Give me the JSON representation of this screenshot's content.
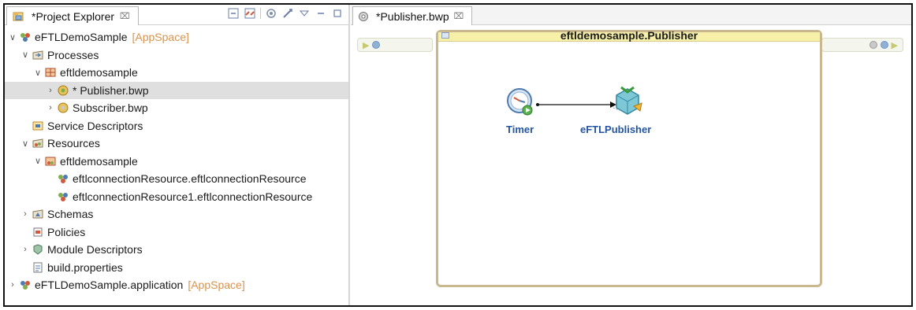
{
  "explorer": {
    "tab_title": "*Project Explorer",
    "close_symbol": "⌧",
    "tree": [
      {
        "label": "eFTLDemoSample",
        "decoration": "[AppSpace]",
        "level": 0,
        "twisty": "open",
        "icon": "module-icon"
      },
      {
        "label": "Processes",
        "level": 1,
        "twisty": "open",
        "icon": "processes-folder-icon"
      },
      {
        "label": "eftldemosample",
        "level": 2,
        "twisty": "open",
        "icon": "package-icon"
      },
      {
        "label": "* Publisher.bwp",
        "level": 3,
        "twisty": "closed",
        "icon": "process-file-icon",
        "selected": true
      },
      {
        "label": "Subscriber.bwp",
        "level": 3,
        "twisty": "closed",
        "icon": "process-file-icon"
      },
      {
        "label": "Service Descriptors",
        "level": 1,
        "twisty": "none",
        "icon": "service-descriptors-icon"
      },
      {
        "label": "Resources",
        "level": 1,
        "twisty": "open",
        "icon": "resources-folder-icon"
      },
      {
        "label": "eftldemosample",
        "level": 2,
        "twisty": "open",
        "icon": "resource-package-icon"
      },
      {
        "label": "eftlconnectionResource.eftlconnectionResource",
        "level": 3,
        "twisty": "none",
        "icon": "connection-resource-icon"
      },
      {
        "label": "eftlconnectionResource1.eftlconnectionResource",
        "level": 3,
        "twisty": "none",
        "icon": "connection-resource-icon"
      },
      {
        "label": "Schemas",
        "level": 1,
        "twisty": "closed",
        "icon": "schemas-folder-icon"
      },
      {
        "label": "Policies",
        "level": 1,
        "twisty": "none",
        "icon": "policies-icon"
      },
      {
        "label": "Module Descriptors",
        "level": 1,
        "twisty": "closed",
        "icon": "module-descriptors-icon"
      },
      {
        "label": "build.properties",
        "level": 1,
        "twisty": "none",
        "icon": "properties-file-icon"
      },
      {
        "label": "eFTLDemoSample.application",
        "decoration": "[AppSpace]",
        "level": 0,
        "twisty": "closed",
        "icon": "application-icon"
      }
    ]
  },
  "editor": {
    "tab_title": "*Publisher.bwp",
    "close_symbol": "⌧",
    "process_title": "eftldemosample.Publisher",
    "activities": [
      {
        "name": "Timer",
        "icon": "timer-icon"
      },
      {
        "name": "eFTLPublisher",
        "icon": "eftl-publisher-icon"
      }
    ]
  },
  "colors": {
    "activity_label": "#2354a2",
    "decoration": "#d9934c",
    "process_border": "#c9b88f",
    "process_header": "#f7f0a8",
    "selection": "#dfdfdf"
  }
}
